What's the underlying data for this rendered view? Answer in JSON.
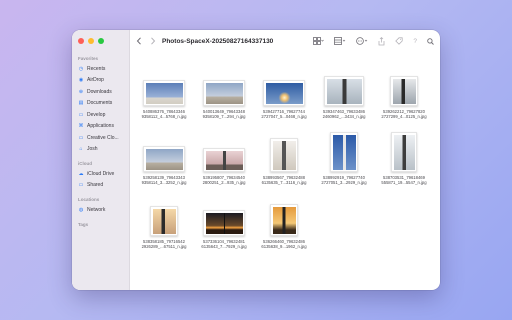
{
  "window": {
    "title": "Photos-SpaceX-20250827164337130"
  },
  "sidebar": {
    "favorites_title": "Favorites",
    "favorites": [
      {
        "label": "Recents",
        "icon": "clock-icon"
      },
      {
        "label": "AirDrop",
        "icon": "airdrop-icon"
      },
      {
        "label": "Downloads",
        "icon": "download-icon"
      },
      {
        "label": "Documents",
        "icon": "document-icon"
      },
      {
        "label": "Develop",
        "icon": "folder-icon"
      },
      {
        "label": "Applications",
        "icon": "applications-icon"
      },
      {
        "label": "Creative Clo...",
        "icon": "folder-icon"
      },
      {
        "label": "Josh",
        "icon": "home-icon"
      }
    ],
    "icloud_title": "iCloud",
    "icloud": [
      {
        "label": "iCloud Drive",
        "icon": "cloud-icon"
      },
      {
        "label": "Shared",
        "icon": "shared-folder-icon"
      }
    ],
    "locations_title": "Locations",
    "locations": [
      {
        "label": "Network",
        "icon": "globe-icon"
      }
    ],
    "tags_title": "Tags"
  },
  "files": [
    {
      "line1": "540886376_78643346",
      "line2": "9358112_4...5768_n.jpg",
      "kind": "sky"
    },
    {
      "line1": "540013649_79643348",
      "line2": "9358109_7...294_n.jpg",
      "kind": "pad"
    },
    {
      "line1": "539427716_79627744",
      "line2": "2727047_5...0468_n.jpg",
      "kind": "launch"
    },
    {
      "line1": "539347463_79633486",
      "line2": "2460962_...3434_n.jpg",
      "kind": "rocket-dark"
    },
    {
      "line1": "539262212_79627820",
      "line2": "2727299_4...0125_n.jpg",
      "kind": "tower"
    },
    {
      "line1": "539258139_79643343",
      "line2": "9358114_3...3252_n.jpg",
      "kind": "pad"
    },
    {
      "line1": "539195807_79634540",
      "line2": "2800251_2...935_n.jpg",
      "kind": "pink"
    },
    {
      "line1": "538993567_79632488",
      "line2": "6135635_7...3116_n.jpg",
      "kind": "tower-pale"
    },
    {
      "line1": "538992919_79627740",
      "line2": "2727051_3...2929_n.jpg",
      "kind": "blue-rocket"
    },
    {
      "line1": "538703531_79618469",
      "line2": "555871_19...5547_n.jpg",
      "kind": "tall"
    },
    {
      "line1": "538358185_79716542",
      "line2": "2926289_...67511_n.jpg",
      "kind": "sunset-tower"
    },
    {
      "line1": "537336104_79632481",
      "line2": "6135643_7...7929_n.jpg",
      "kind": "dusk"
    },
    {
      "line1": "536266460_79632486",
      "line2": "6135638_9...1962_n.jpg",
      "kind": "sunset"
    }
  ]
}
